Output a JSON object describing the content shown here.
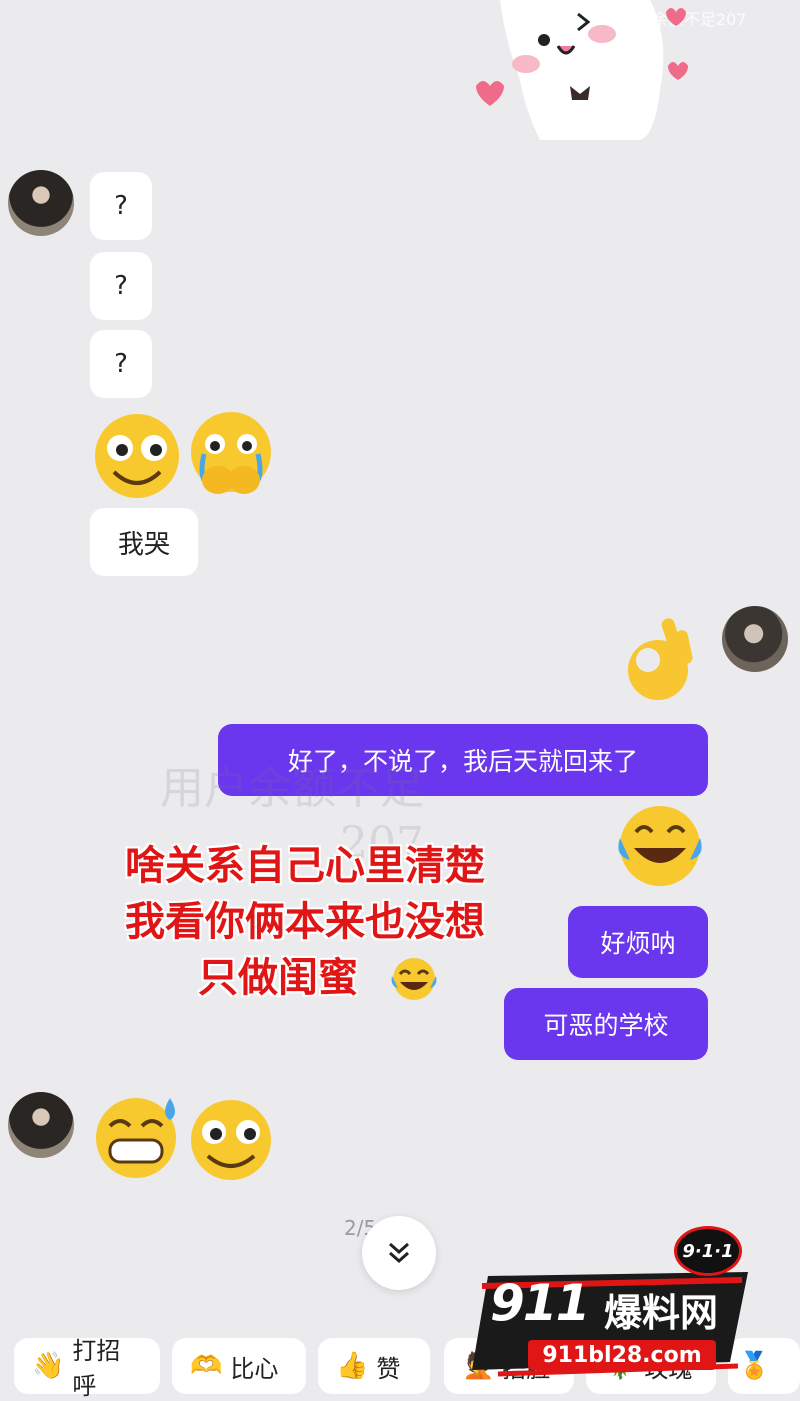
{
  "watermark_top": "余额不足207",
  "watermark_center": "用户余额不足",
  "watermark_center2": "207",
  "left_messages": [
    "?",
    "?",
    "?",
    "我哭"
  ],
  "right_messages": [
    "好了，不说了，我后天就回来了",
    "好烦呐",
    "可恶的学校"
  ],
  "caption": {
    "line1": "啥关系自己心里清楚",
    "line2": "我看你俩本来也没想",
    "line3": "只做闺蜜"
  },
  "timestamp": "2/5 00",
  "quick_replies": [
    {
      "icon": "wave-icon",
      "label": "打招呼"
    },
    {
      "icon": "heart-hands-icon",
      "label": "比心"
    },
    {
      "icon": "thumbs-up-icon",
      "label": "赞"
    },
    {
      "icon": "face-icon",
      "label": "捂脸"
    },
    {
      "icon": "rose-icon",
      "label": "玫瑰"
    }
  ],
  "logo": {
    "badge": "9·1·1",
    "title_num": "911",
    "title_cn": "爆料网",
    "url": "911bl28.com"
  },
  "colors": {
    "background": "#ebeaed",
    "sent_bubble": "#6a36ee",
    "received_bubble": "#ffffff",
    "caption_red": "#e01515"
  }
}
